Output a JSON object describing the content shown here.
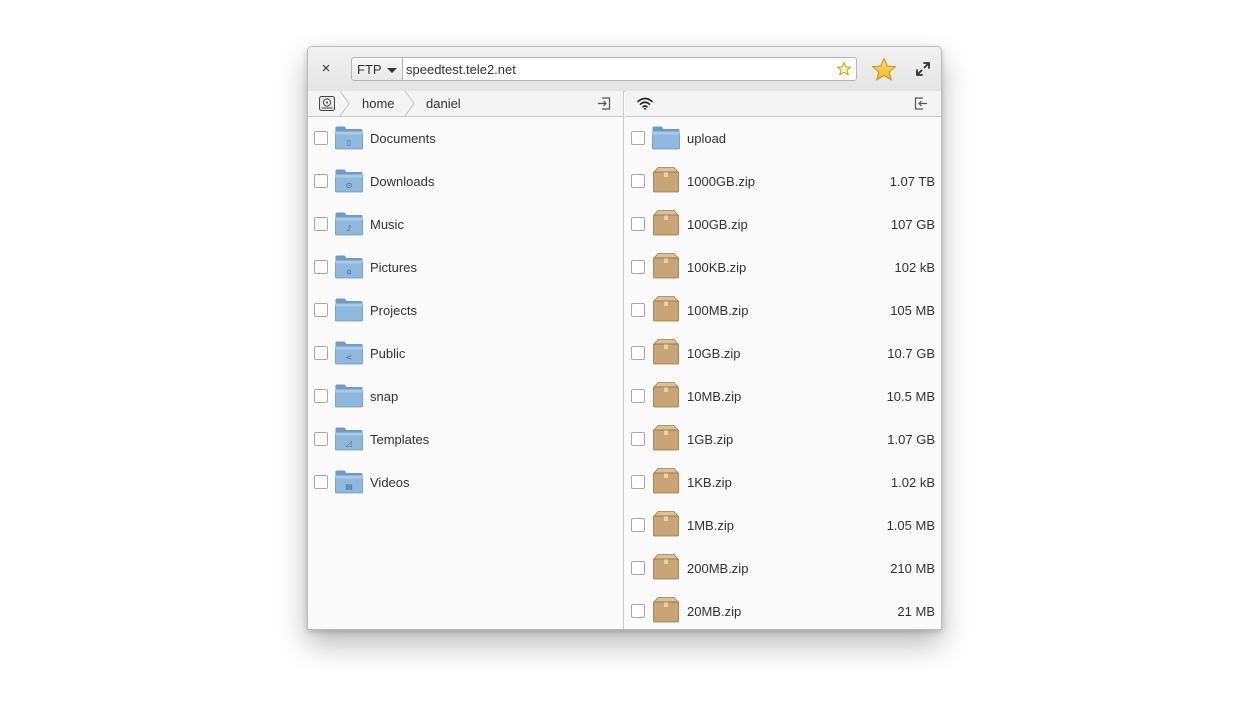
{
  "toolbar": {
    "close_label": "×",
    "protocol": "FTP",
    "address": "speedtest.tele2.net"
  },
  "left_pane": {
    "breadcrumb": [
      "home",
      "daniel"
    ],
    "items": [
      {
        "name": "Documents",
        "glyph": "▯"
      },
      {
        "name": "Downloads",
        "glyph": "⊙"
      },
      {
        "name": "Music",
        "glyph": "♪"
      },
      {
        "name": "Pictures",
        "glyph": "⌂"
      },
      {
        "name": "Projects",
        "glyph": ""
      },
      {
        "name": "Public",
        "glyph": "<"
      },
      {
        "name": "snap",
        "glyph": ""
      },
      {
        "name": "Templates",
        "glyph": "◿"
      },
      {
        "name": "Videos",
        "glyph": "▤"
      }
    ]
  },
  "right_pane": {
    "items": [
      {
        "name": "upload",
        "size": "",
        "kind": "folder"
      },
      {
        "name": "1000GB.zip",
        "size": "1.07 TB",
        "kind": "archive"
      },
      {
        "name": "100GB.zip",
        "size": "107 GB",
        "kind": "archive"
      },
      {
        "name": "100KB.zip",
        "size": "102 kB",
        "kind": "archive"
      },
      {
        "name": "100MB.zip",
        "size": "105 MB",
        "kind": "archive"
      },
      {
        "name": "10GB.zip",
        "size": "10.7 GB",
        "kind": "archive"
      },
      {
        "name": "10MB.zip",
        "size": "10.5 MB",
        "kind": "archive"
      },
      {
        "name": "1GB.zip",
        "size": "1.07 GB",
        "kind": "archive"
      },
      {
        "name": "1KB.zip",
        "size": "1.02 kB",
        "kind": "archive"
      },
      {
        "name": "1MB.zip",
        "size": "1.05 MB",
        "kind": "archive"
      },
      {
        "name": "200MB.zip",
        "size": "210 MB",
        "kind": "archive"
      },
      {
        "name": "20MB.zip",
        "size": "21 MB",
        "kind": "archive"
      }
    ]
  },
  "colors": {
    "folder": "#8fb8dc",
    "archive": "#c8a476",
    "bookmark_star": "#f5c22d"
  }
}
